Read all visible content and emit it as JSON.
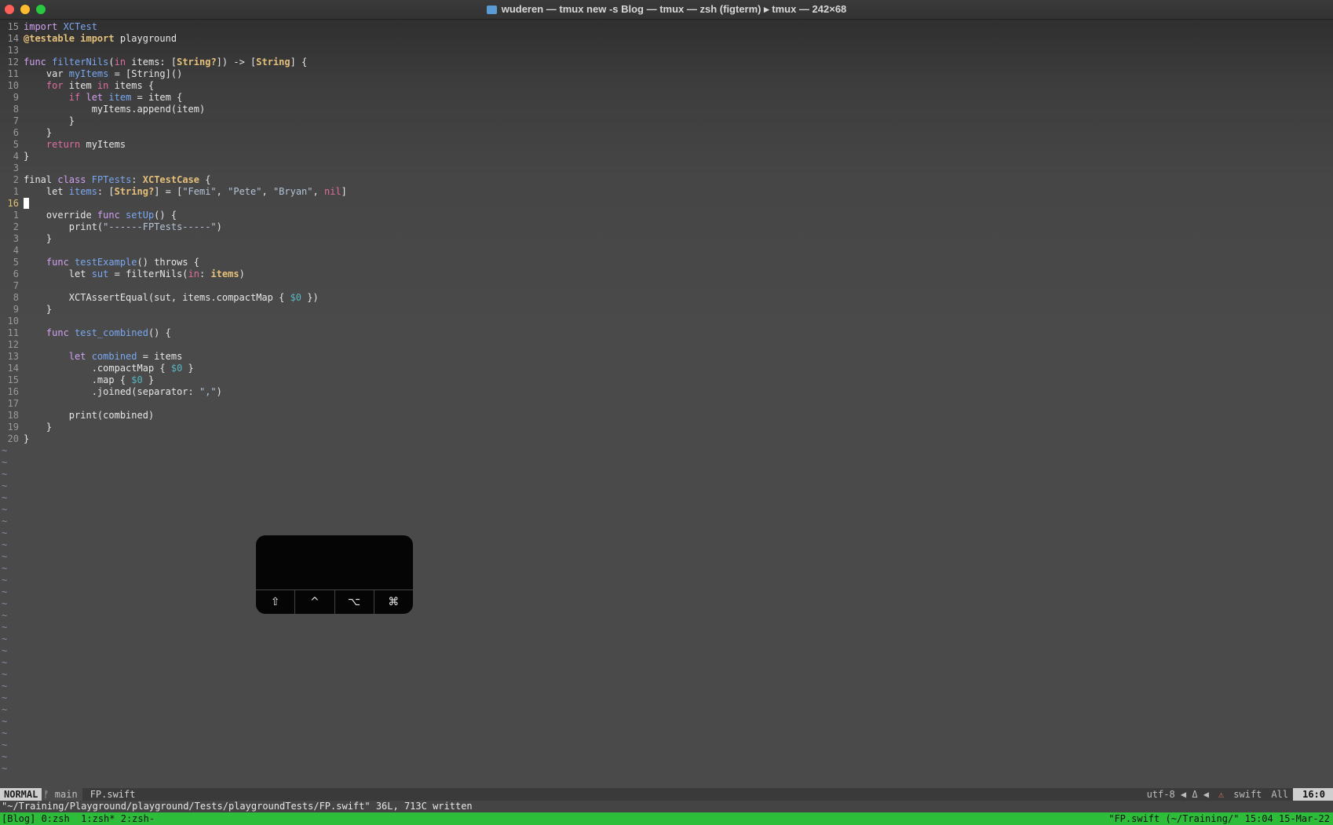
{
  "window": {
    "title": "wuderen — tmux new -s Blog — tmux — zsh (figterm) ▸ tmux — 242×68",
    "folder_icon": "folder-icon"
  },
  "editor": {
    "lines": [
      {
        "n": "15",
        "tokens": [
          [
            "kw2",
            "import "
          ],
          [
            "fn",
            "XCTest"
          ]
        ]
      },
      {
        "n": "14",
        "tokens": [
          [
            "typ",
            "@testable "
          ],
          [
            "typ",
            "import "
          ],
          [
            "",
            "playground"
          ]
        ]
      },
      {
        "n": "13",
        "tokens": []
      },
      {
        "n": "12",
        "tokens": [
          [
            "kw2",
            "func "
          ],
          [
            "fn",
            "filterNils"
          ],
          [
            "",
            "("
          ],
          [
            "kw",
            "in "
          ],
          [
            "",
            "items: ["
          ],
          [
            "typ",
            "String?"
          ],
          [
            "",
            "]) -> ["
          ],
          [
            "typ",
            "String"
          ],
          [
            "",
            "] {"
          ]
        ]
      },
      {
        "n": "11",
        "tokens": [
          [
            "",
            "    var "
          ],
          [
            "fn",
            "myItems"
          ],
          [
            "",
            " = [String]()"
          ]
        ]
      },
      {
        "n": "10",
        "tokens": [
          [
            "kw",
            "    for "
          ],
          [
            "",
            "item "
          ],
          [
            "kw",
            "in "
          ],
          [
            "",
            "items {"
          ]
        ]
      },
      {
        "n": "9",
        "tokens": [
          [
            "kw",
            "        if "
          ],
          [
            "kw2",
            "let "
          ],
          [
            "fn",
            "item"
          ],
          [
            "",
            " = item {"
          ]
        ]
      },
      {
        "n": "8",
        "tokens": [
          [
            "",
            "            myItems.append(item)"
          ]
        ]
      },
      {
        "n": "7",
        "tokens": [
          [
            "",
            "        }"
          ]
        ]
      },
      {
        "n": "6",
        "tokens": [
          [
            "",
            "    }"
          ]
        ]
      },
      {
        "n": "5",
        "tokens": [
          [
            "kw",
            "    return "
          ],
          [
            "",
            "myItems"
          ]
        ]
      },
      {
        "n": "4",
        "tokens": [
          [
            "",
            "}"
          ]
        ]
      },
      {
        "n": "3",
        "tokens": []
      },
      {
        "n": "2",
        "tokens": [
          [
            "",
            "final "
          ],
          [
            "kw2",
            "class "
          ],
          [
            "fn",
            "FPTests"
          ],
          [
            "",
            ": "
          ],
          [
            "typ",
            "XCTestCase"
          ],
          [
            "",
            " {"
          ]
        ]
      },
      {
        "n": "1",
        "tokens": [
          [
            "",
            "    let "
          ],
          [
            "fn",
            "items"
          ],
          [
            "",
            ": ["
          ],
          [
            "typ",
            "String?"
          ],
          [
            "",
            "] = ["
          ],
          [
            "str",
            "\"Femi\""
          ],
          [
            "",
            ", "
          ],
          [
            "str",
            "\"Pete\""
          ],
          [
            "",
            ", "
          ],
          [
            "str",
            "\"Bryan\""
          ],
          [
            "",
            ", "
          ],
          [
            "kw",
            "nil"
          ],
          [
            "",
            "]"
          ]
        ]
      },
      {
        "n": "16",
        "tokens": [
          [
            "cursor",
            ""
          ]
        ],
        "current": true
      },
      {
        "n": "1",
        "tokens": [
          [
            "",
            "    override "
          ],
          [
            "kw2",
            "func "
          ],
          [
            "fn",
            "setUp"
          ],
          [
            "",
            "() {"
          ]
        ]
      },
      {
        "n": "2",
        "tokens": [
          [
            "",
            "        print("
          ],
          [
            "str",
            "\"------FPTests-----\""
          ],
          [
            "",
            ")"
          ]
        ]
      },
      {
        "n": "3",
        "tokens": [
          [
            "",
            "    }"
          ]
        ]
      },
      {
        "n": "4",
        "tokens": []
      },
      {
        "n": "5",
        "tokens": [
          [
            "kw2",
            "    func "
          ],
          [
            "fn",
            "testExample"
          ],
          [
            "",
            "() throws {"
          ]
        ]
      },
      {
        "n": "6",
        "tokens": [
          [
            "",
            "        let "
          ],
          [
            "fn",
            "sut"
          ],
          [
            "",
            " = filterNils("
          ],
          [
            "kw",
            "in"
          ],
          [
            "",
            ": "
          ],
          [
            "typ",
            "items"
          ],
          [
            "",
            ")"
          ]
        ]
      },
      {
        "n": "7",
        "tokens": []
      },
      {
        "n": "8",
        "tokens": [
          [
            "",
            "        XCTAssertEqual(sut, items.compactMap { "
          ],
          [
            "num",
            "$0"
          ],
          [
            "",
            " })"
          ]
        ]
      },
      {
        "n": "9",
        "tokens": [
          [
            "",
            "    }"
          ]
        ]
      },
      {
        "n": "10",
        "tokens": []
      },
      {
        "n": "11",
        "tokens": [
          [
            "kw2",
            "    func "
          ],
          [
            "fn",
            "test_combined"
          ],
          [
            "",
            "() {"
          ]
        ]
      },
      {
        "n": "12",
        "tokens": []
      },
      {
        "n": "13",
        "tokens": [
          [
            "kw2",
            "        let "
          ],
          [
            "fn",
            "combined"
          ],
          [
            "",
            " = items"
          ]
        ]
      },
      {
        "n": "14",
        "tokens": [
          [
            "",
            "            .compactMap { "
          ],
          [
            "num",
            "$0"
          ],
          [
            "",
            " }"
          ]
        ]
      },
      {
        "n": "15",
        "tokens": [
          [
            "",
            "            .map { "
          ],
          [
            "num",
            "$0"
          ],
          [
            "",
            " }"
          ]
        ]
      },
      {
        "n": "16",
        "tokens": [
          [
            "",
            "            .joined(separator: "
          ],
          [
            "str",
            "\",\""
          ],
          [
            "",
            ")"
          ]
        ]
      },
      {
        "n": "17",
        "tokens": []
      },
      {
        "n": "18",
        "tokens": [
          [
            "",
            "        print(combined)"
          ]
        ]
      },
      {
        "n": "19",
        "tokens": [
          [
            "",
            "    }"
          ]
        ]
      },
      {
        "n": "20",
        "tokens": [
          [
            "",
            "}"
          ]
        ]
      }
    ],
    "tilde_char": "~",
    "tilde_count": 28
  },
  "overlay": {
    "keys": [
      {
        "name": "shift-key-icon",
        "glyph": "⇧"
      },
      {
        "name": "control-key-icon",
        "glyph": "^"
      },
      {
        "name": "option-key-icon",
        "glyph": "⌥"
      },
      {
        "name": "command-key-icon",
        "glyph": "⌘"
      }
    ]
  },
  "statusline": {
    "mode": "NORMAL",
    "branch": "ᚠ main",
    "file": "FP.swift",
    "encoding": "utf-8 ◀ Δ ◀",
    "warn": "⚠",
    "filetype": "swift",
    "scroll": "All",
    "position": "16:0"
  },
  "cmdline": "\"~/Training/Playground/playground/Tests/playgroundTests/FP.swift\" 36L, 713C written",
  "tmux": {
    "left": "[Blog] 0:zsh  1:zsh* 2:zsh-",
    "right": "\"FP.swift (~/Training/\" 15:04 15-Mar-22"
  }
}
